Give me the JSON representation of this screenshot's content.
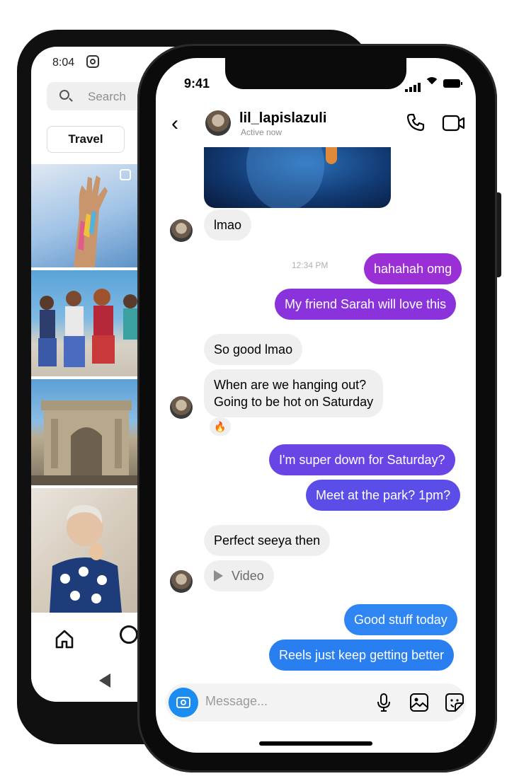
{
  "back_phone": {
    "status_time": "8:04",
    "search_placeholder": "Search",
    "chip_label": "Travel",
    "nav_icons": [
      "home-icon",
      "search-icon",
      "back-triangle-icon"
    ]
  },
  "status_bar": {
    "time": "9:41"
  },
  "header": {
    "username": "lil_lapislazuli",
    "status": "Active now",
    "icons": [
      "back-chevron-icon",
      "phone-icon",
      "video-call-icon"
    ]
  },
  "messages": [
    {
      "from": "them",
      "text": "lmao"
    },
    {
      "timestamp": "12:34 PM"
    },
    {
      "from": "me",
      "text": "hahahah omg"
    },
    {
      "from": "me",
      "text": "My friend Sarah will love this"
    },
    {
      "from": "them",
      "text": "So good lmao"
    },
    {
      "from": "them",
      "lines": [
        "When are we hanging out?",
        "Going to be hot on Saturday"
      ],
      "reaction": "🔥"
    },
    {
      "from": "me",
      "text": "I'm super down for Saturday?"
    },
    {
      "from": "me",
      "text": "Meet at the park? 1pm?"
    },
    {
      "from": "them",
      "text": "Perfect seeya then"
    },
    {
      "from": "them",
      "text": "Video",
      "icon": "play-icon"
    },
    {
      "from": "me",
      "text": "Good stuff today"
    },
    {
      "from": "me",
      "text": "Reels just keep getting better"
    }
  ],
  "composer": {
    "placeholder": "Message...",
    "icons": [
      "camera-icon",
      "microphone-icon",
      "gallery-icon",
      "sticker-icon"
    ]
  },
  "colors": {
    "purple": "#9b2fd6",
    "violet": "#7a3be8",
    "indigo": "#5b4ee8",
    "blue": "#2f7bf0",
    "incoming_bg": "#efefef",
    "camera_blue": "#1a8cf2"
  }
}
